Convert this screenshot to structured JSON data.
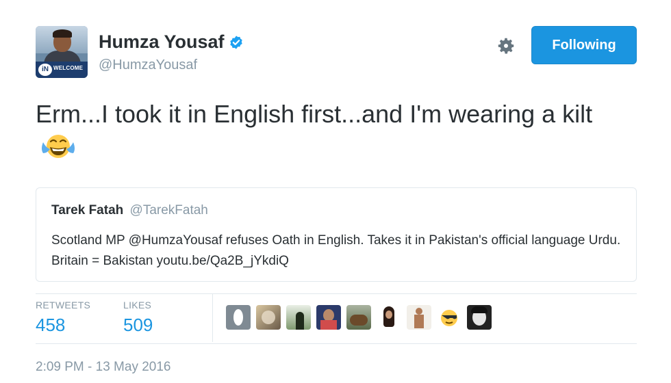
{
  "author": {
    "display_name": "Humza Yousaf",
    "handle": "@HumzaYousaf",
    "avatar_badge_text": "WELCOME",
    "avatar_badge_logo": "iN",
    "verified_icon": "verified-badge-icon"
  },
  "actions": {
    "settings_icon": "gear-icon",
    "follow_label": "Following",
    "accent": "#1b95e0"
  },
  "tweet": {
    "text": "Erm...I took it in English first...and I'm wearing a kilt",
    "emoji": "face-with-tears-of-joy"
  },
  "quoted_tweet": {
    "display_name": "Tarek Fatah",
    "handle": "@TarekFatah",
    "text": "Scotland MP @HumzaYousaf refuses Oath in English. Takes it in Pakistan's official language Urdu. Britain = Bakistan youtu.be/Qa2B_jYkdiQ"
  },
  "stats": {
    "retweets_label": "RETWEETS",
    "retweets_value": "458",
    "likes_label": "LIKES",
    "likes_value": "509"
  },
  "timestamp": "2:09 PM - 13 May 2016"
}
